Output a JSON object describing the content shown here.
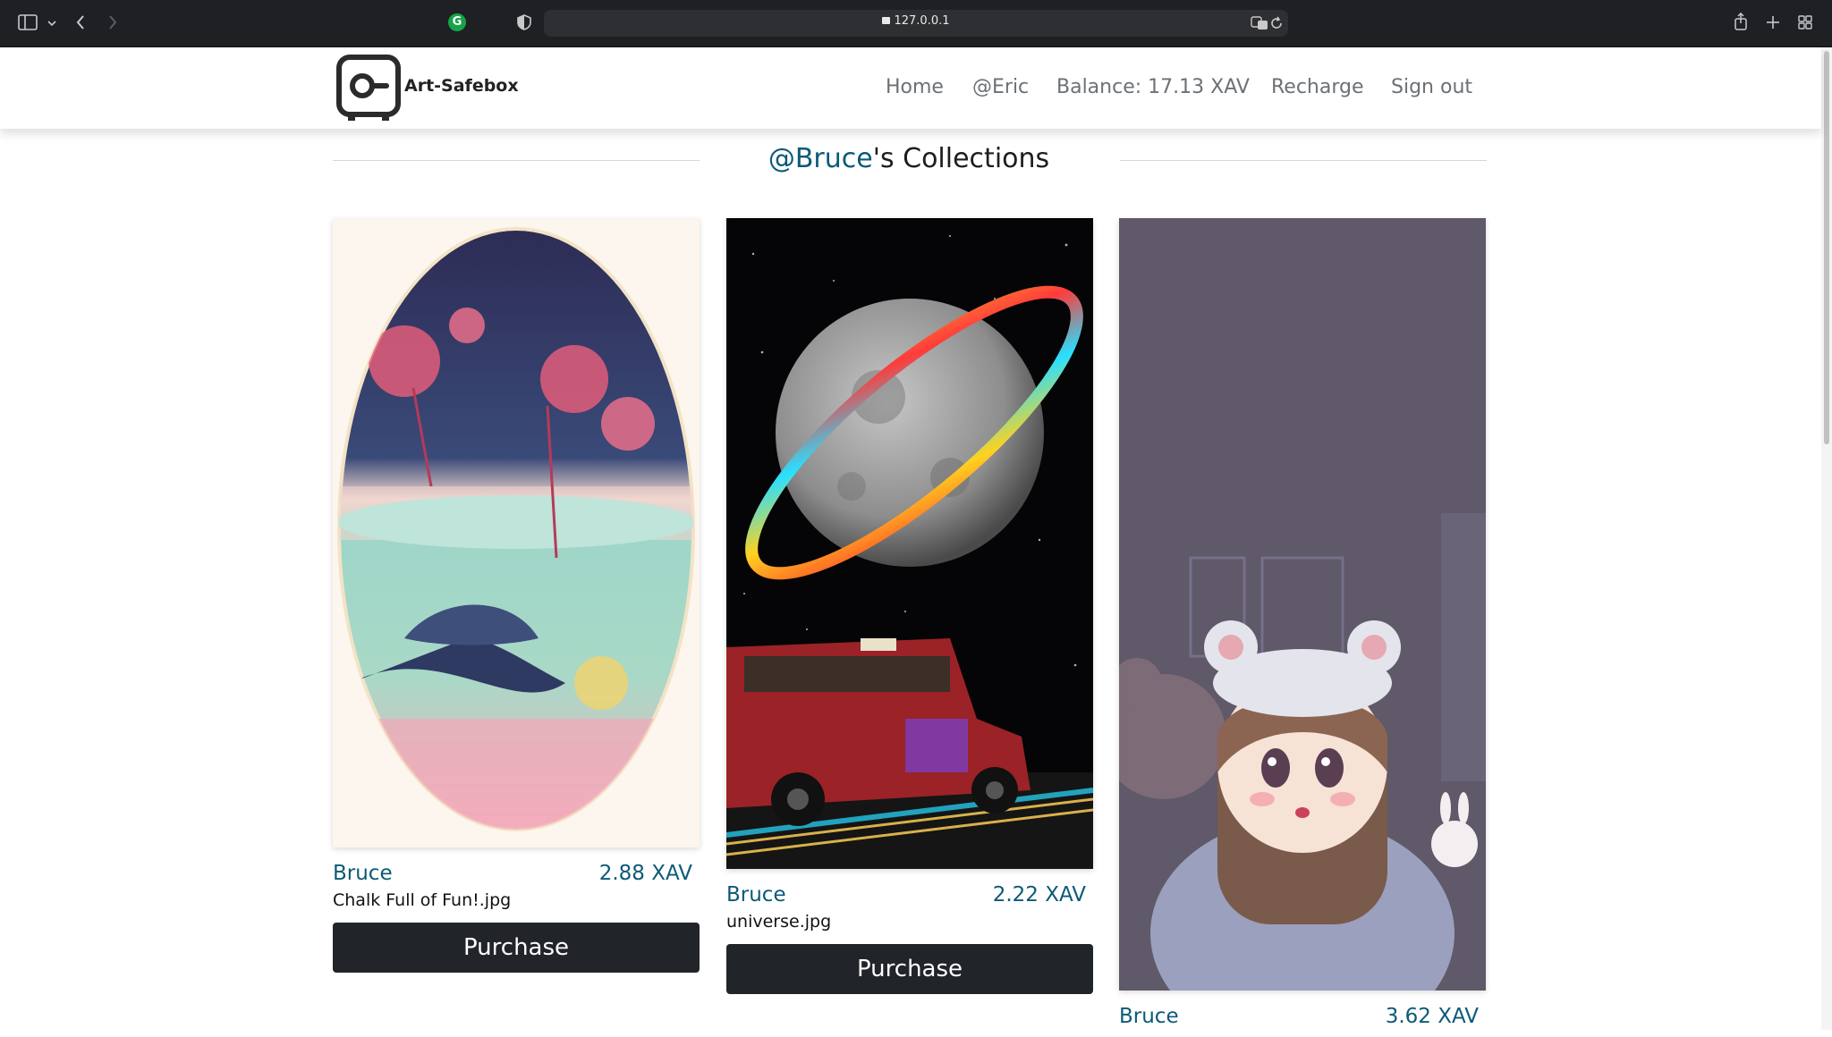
{
  "browser": {
    "url": "127.0.0.1",
    "icons": [
      "sidebar-icon",
      "chevron-down-icon",
      "back-icon",
      "forward-icon",
      "grammarly-icon",
      "shield-icon",
      "lock-icon",
      "translate-icon",
      "reload-icon",
      "share-icon",
      "new-tab-icon",
      "tab-overview-icon"
    ]
  },
  "site": {
    "brand": "Art-Safebox",
    "nav": {
      "home": "Home",
      "user": "@Eric",
      "balance": "Balance: 17.13 XAV",
      "recharge": "Recharge",
      "signout": "Sign out"
    }
  },
  "heading": {
    "user": "@Bruce",
    "suffix": "'s Collections"
  },
  "cards": [
    {
      "owner": "Bruce",
      "price": "2.88 XAV",
      "filename": "Chalk Full of Fun!.jpg",
      "button": "Purchase"
    },
    {
      "owner": "Bruce",
      "price": "2.22 XAV",
      "filename": "universe.jpg",
      "button": "Purchase"
    },
    {
      "owner": "Bruce",
      "price": "3.62 XAV"
    }
  ],
  "colors": {
    "accent": "#0b5a78",
    "button": "#212529",
    "chrome": "#1f2023"
  }
}
